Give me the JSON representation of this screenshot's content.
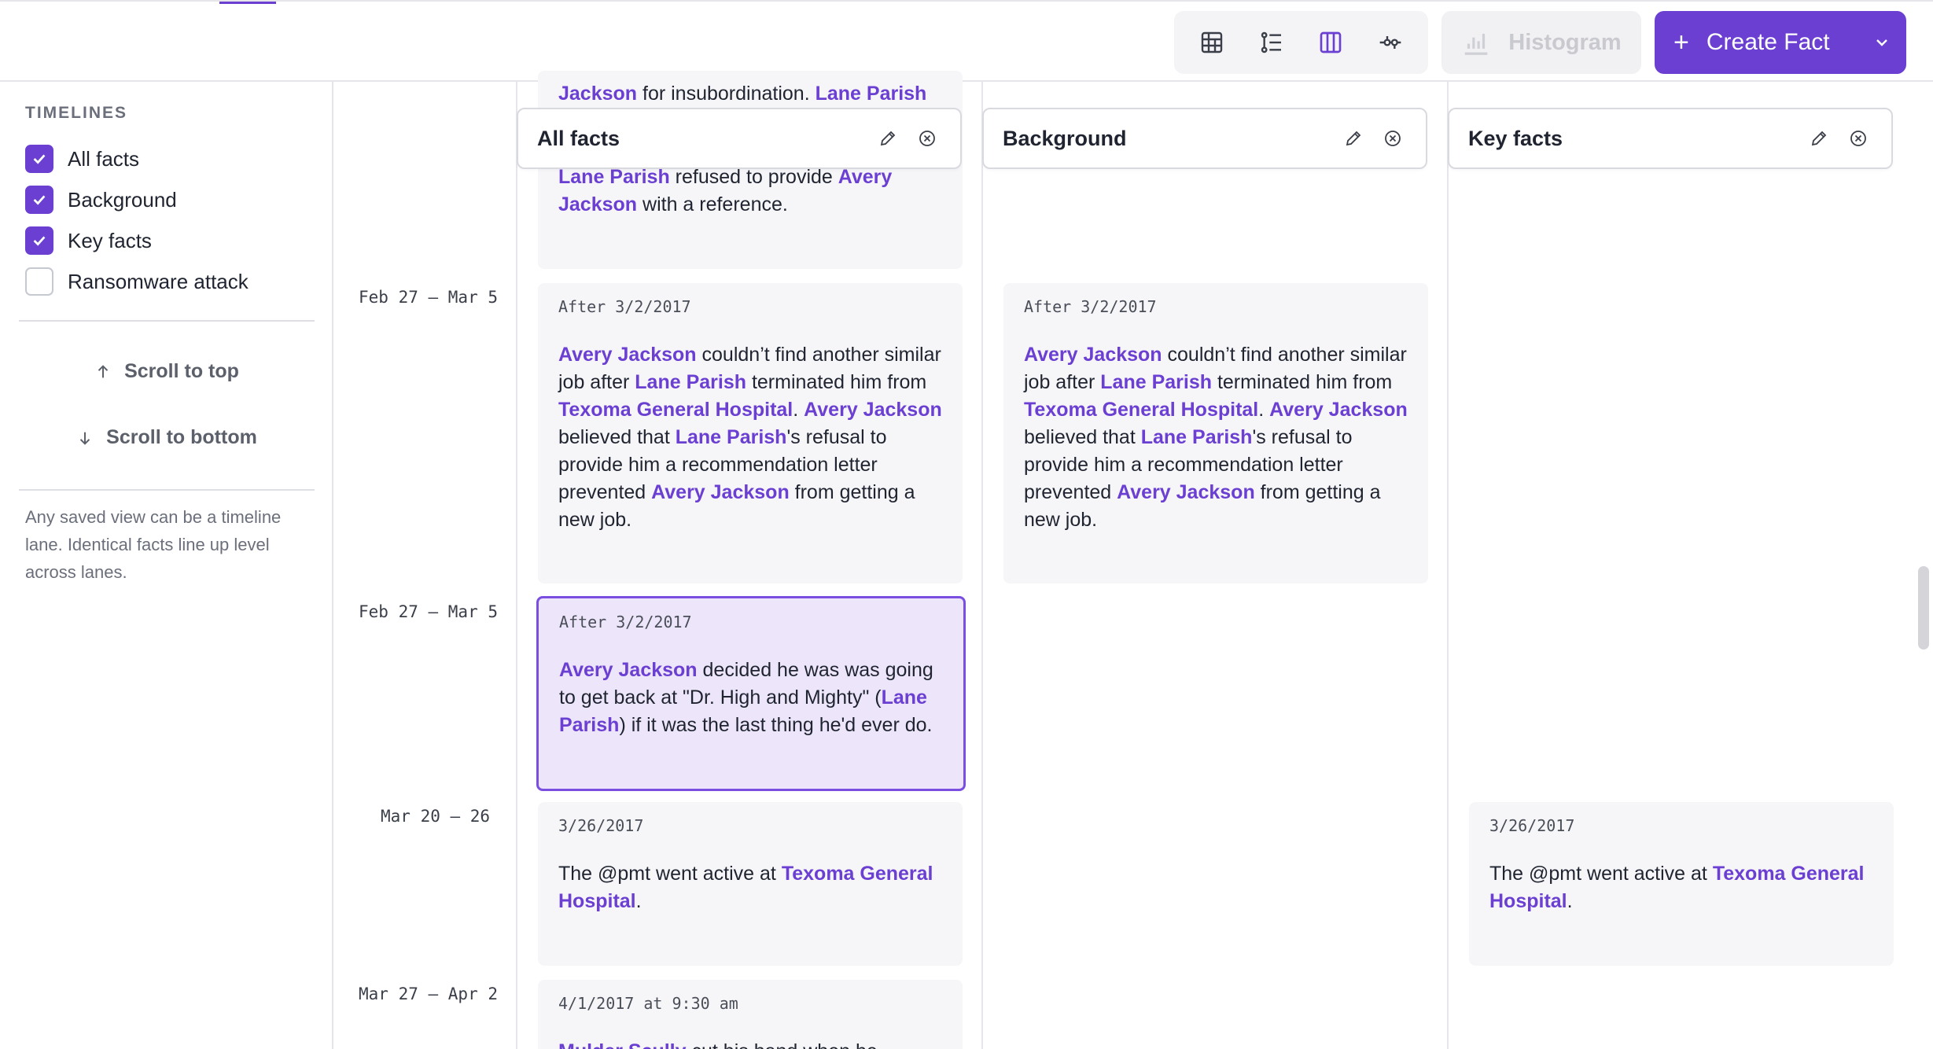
{
  "toolbar": {
    "views": [
      "table-view-icon",
      "list-view-icon",
      "lanes-view-icon",
      "timeline-view-icon"
    ],
    "histogram_label": "Histogram",
    "create_label": "Create Fact"
  },
  "sidebar": {
    "heading": "TIMELINES",
    "items": [
      {
        "label": "All facts",
        "checked": true
      },
      {
        "label": "Background",
        "checked": true
      },
      {
        "label": "Key facts",
        "checked": true
      },
      {
        "label": "Ransomware attack",
        "checked": false
      }
    ],
    "scroll_top": "Scroll to top",
    "scroll_bottom": "Scroll to bottom",
    "note": "Any saved view can be a timeline lane. Identical facts line up level across lanes."
  },
  "lanes": [
    {
      "title": "All facts"
    },
    {
      "title": "Background"
    },
    {
      "title": "Key facts"
    }
  ],
  "dates": [
    "Feb 27 – Mar 5",
    "Feb 27 – Mar 5",
    "Mar 20 – 26",
    "Mar 27 – Apr 2"
  ],
  "cards": {
    "top_partial_1": {
      "a": "Jackson",
      "b": " for insubordination. ",
      "c": "Lane Parish"
    },
    "top_partial_2": {
      "a": "Lane Parish",
      "b": " refused to provide ",
      "c": "Avery",
      "d": "Jackson",
      "e": " with a reference."
    },
    "fact_job": {
      "date": "After 3/2/2017",
      "p1": "Avery Jackson",
      "p2": " couldn’t find another similar job after ",
      "p3": "Lane Parish",
      "p4": " terminated him from ",
      "p5": "Texoma General Hospital",
      "p6": ". ",
      "p7": "Avery Jackson",
      "p8": " believed that ",
      "p9": "Lane Parish",
      "p10": "'s refusal to provide him a recommendation letter prevented ",
      "p11": "Avery Jackson",
      "p12": " from getting a new job."
    },
    "fact_revenge": {
      "date": "After 3/2/2017",
      "p1": "Avery Jackson",
      "p2": " decided he was was going to get back at \"Dr. High and Mighty\" (",
      "p3": "Lane Parish",
      "p4": ") if it was the last thing he'd ever do."
    },
    "fact_pmt": {
      "date": "3/26/2017",
      "p1": "The @pmt went active at ",
      "p2": "Texoma General Hospital",
      "p3": "."
    },
    "fact_bottom": {
      "date": "4/1/2017 at 9:30 am",
      "p1": "Mulder Scully",
      "p2": " cut his hand when he"
    }
  },
  "colors": {
    "accent": "#6a3fd1",
    "card_bg": "#f6f6f9",
    "selected_bg": "#ede6fb"
  }
}
